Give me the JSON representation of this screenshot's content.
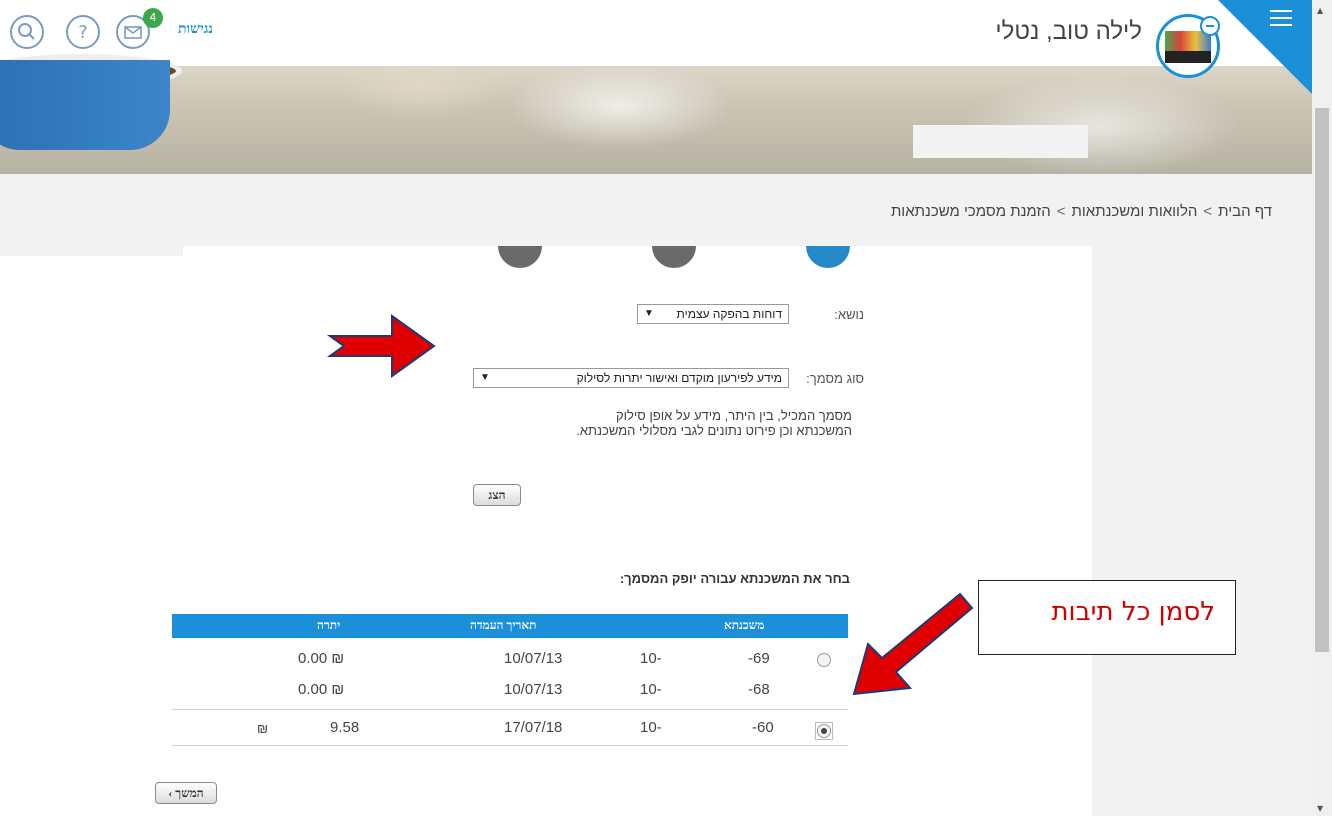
{
  "header": {
    "greeting": "לילה טוב, נטלי",
    "accessibility_label": "נגישות",
    "messages_count": "4"
  },
  "breadcrumb": {
    "items": [
      "דף הבית",
      "הלוואות ומשכנתאות",
      "הזמנת מסמכי משכנתאות"
    ],
    "separator": ">"
  },
  "form": {
    "subject_label": "נושא:",
    "subject_value": "דוחות בהפקה עצמית",
    "doctype_label": "סוג מסמך:",
    "doctype_value": "מידע לפירעון מוקדם ואישור יתרות לסילוק",
    "description_line1": "מסמך המכיל, בין היתר, מידע על אופן סילוק",
    "description_line2": "המשכנתא וכן פירוט נתונים לגבי מסלולי המשכנתא.",
    "show_button": "הצג",
    "choose_label": "בחר את המשכנתא עבורה יופק המסמך:",
    "next_button": "המשך"
  },
  "table": {
    "headers": [
      "משכנתא",
      "תאריך העמדה",
      "יתרה"
    ],
    "rows": [
      {
        "loan_prefix": "10-",
        "loan_suffix": "-69",
        "date": "10/07/13",
        "balance": "₪ 0.00",
        "selected": false
      },
      {
        "loan_prefix": "10-",
        "loan_suffix": "-68",
        "date": "10/07/13",
        "balance": "₪ 0.00",
        "selected": false
      },
      {
        "loan_prefix": "10-",
        "loan_suffix": "-60",
        "date": "17/07/18",
        "balance_prefix": "₪",
        "balance_suffix": "9.58",
        "selected": true
      }
    ]
  },
  "annotation": {
    "text": "לסמן כל תיבות"
  },
  "colors": {
    "accent": "#1b8fd7",
    "arrow_red": "#e00000"
  },
  "icons": [
    "menu-icon",
    "search-icon",
    "help-icon",
    "mail-icon",
    "chevron-left-icon"
  ]
}
